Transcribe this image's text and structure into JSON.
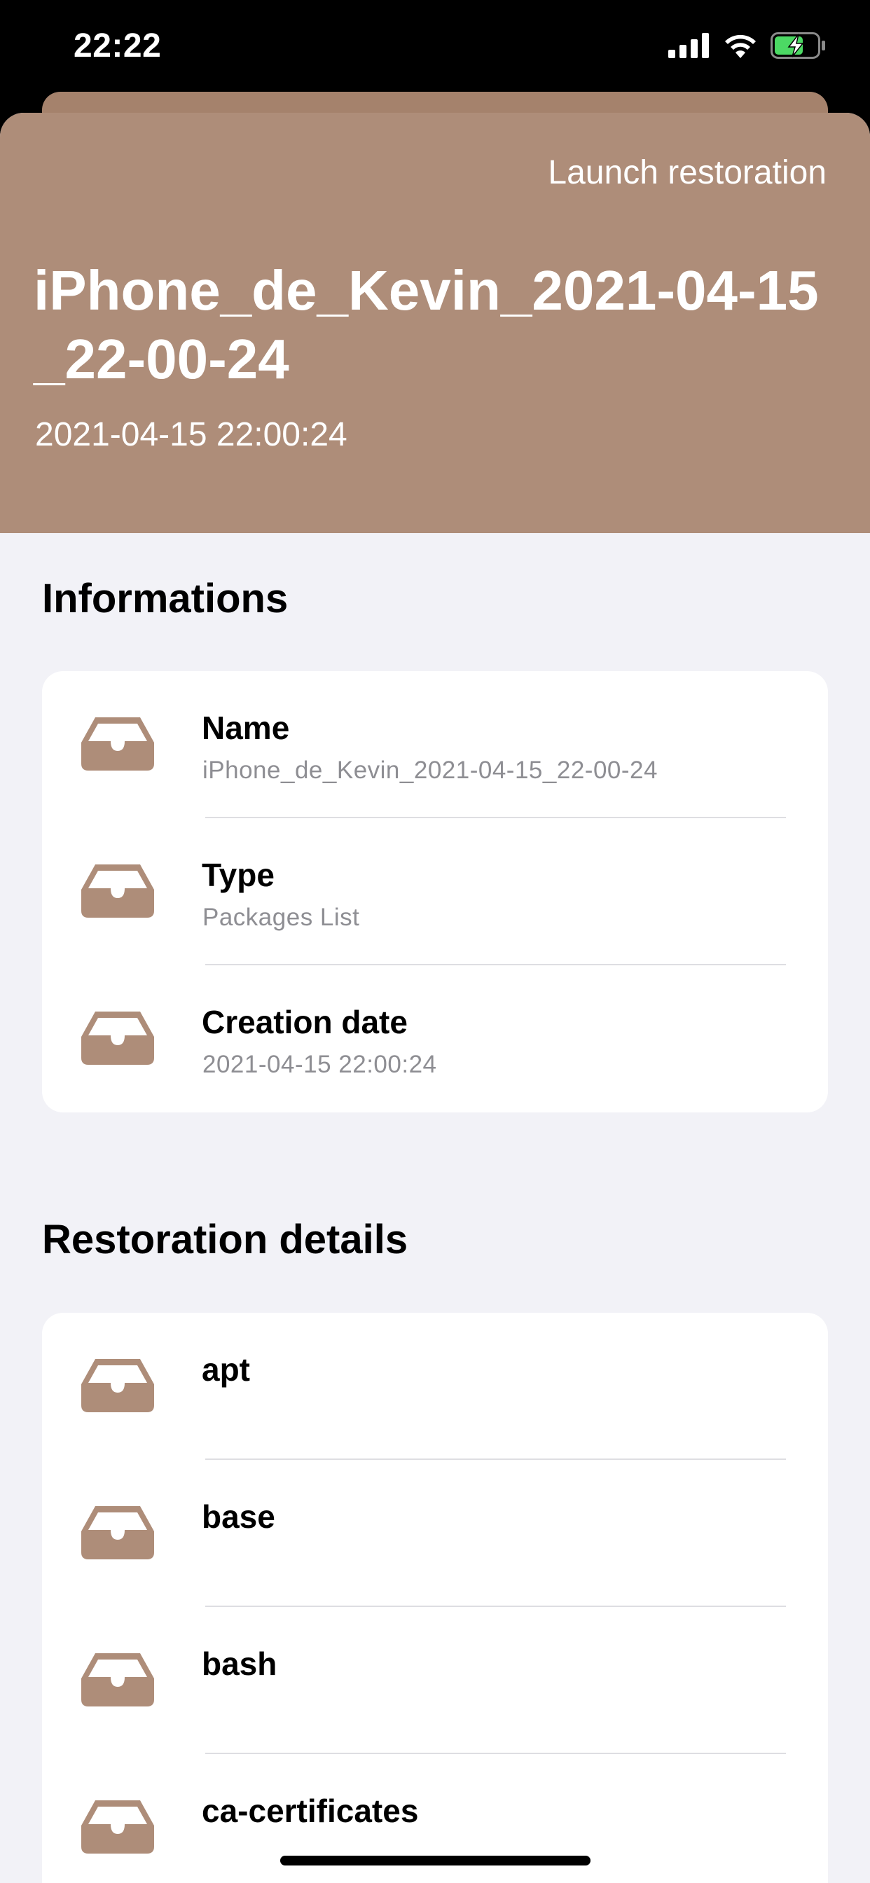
{
  "status_bar": {
    "time": "22:22",
    "icons": [
      "cellular-signal-icon",
      "wifi-icon",
      "battery-charging-icon"
    ],
    "battery_color": "#4cd964"
  },
  "header": {
    "action_label": "Launch restoration",
    "title": "iPhone_de_Kevin_2021-04-15_22-00-24",
    "subtitle": "2021-04-15 22:00:24",
    "accent_color": "#ae8d79"
  },
  "informations": {
    "section_title": "Informations",
    "rows": [
      {
        "icon": "tray-icon",
        "title": "Name",
        "subtitle": "iPhone_de_Kevin_2021-04-15_22-00-24"
      },
      {
        "icon": "tray-icon",
        "title": "Type",
        "subtitle": "Packages List"
      },
      {
        "icon": "tray-icon",
        "title": "Creation date",
        "subtitle": "2021-04-15 22:00:24"
      }
    ]
  },
  "restoration": {
    "section_title": "Restoration details",
    "rows": [
      {
        "icon": "tray-icon",
        "title": "apt"
      },
      {
        "icon": "tray-icon",
        "title": "base"
      },
      {
        "icon": "tray-icon",
        "title": "bash"
      },
      {
        "icon": "tray-icon",
        "title": "ca-certificates"
      }
    ]
  }
}
